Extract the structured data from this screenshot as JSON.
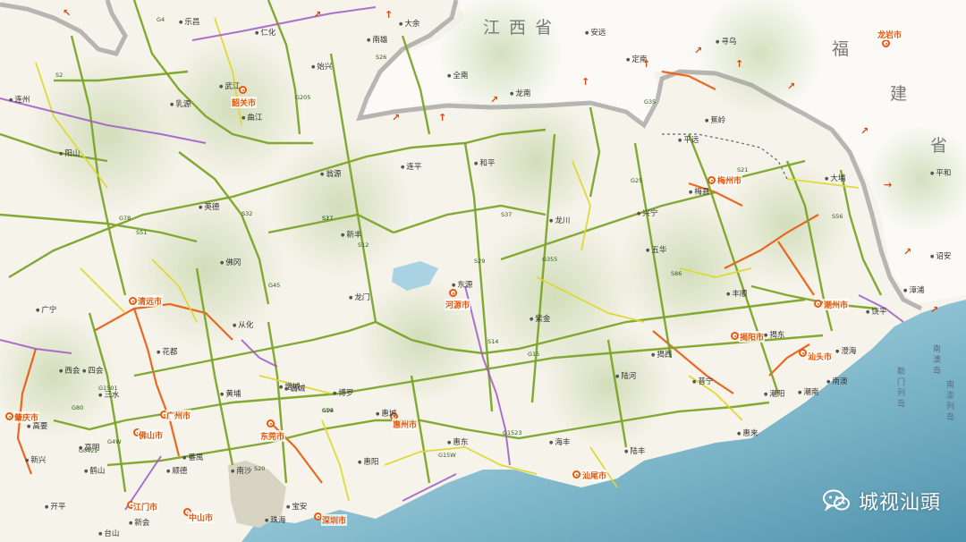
{
  "provinces": [
    {
      "id": "jiangxi",
      "label": "江 西 省"
    },
    {
      "id": "fujian1",
      "label": "福"
    },
    {
      "id": "fujian2",
      "label": "建"
    },
    {
      "id": "fujian3",
      "label": "省"
    }
  ],
  "prefecture_cities": [
    {
      "id": "shaoguan",
      "label": "韶关市"
    },
    {
      "id": "qingyuan",
      "label": "清远市"
    },
    {
      "id": "heyuan",
      "label": "河源市"
    },
    {
      "id": "meizhou",
      "label": "梅州市"
    },
    {
      "id": "chaozhou",
      "label": "潮州市"
    },
    {
      "id": "jieyang",
      "label": "揭阳市"
    },
    {
      "id": "shantou",
      "label": "汕头市"
    },
    {
      "id": "shanwei",
      "label": "汕尾市"
    },
    {
      "id": "huizhou",
      "label": "惠州市"
    },
    {
      "id": "dongguan",
      "label": "东莞市"
    },
    {
      "id": "guangzhou",
      "label": "广州市"
    },
    {
      "id": "foshan",
      "label": "佛山市"
    },
    {
      "id": "zhaoqing",
      "label": "肇庆市"
    },
    {
      "id": "shenzhen",
      "label": "深圳市"
    },
    {
      "id": "zhongshan",
      "label": "中山市"
    },
    {
      "id": "jiangmen",
      "label": "江门市"
    },
    {
      "id": "longyan",
      "label": "龙岩市"
    }
  ],
  "counties": [
    {
      "id": "c1",
      "label": "乐昌"
    },
    {
      "id": "c2",
      "label": "仁化"
    },
    {
      "id": "c3",
      "label": "南雄"
    },
    {
      "id": "c4",
      "label": "始兴"
    },
    {
      "id": "c5",
      "label": "翁源"
    },
    {
      "id": "c6",
      "label": "连平"
    },
    {
      "id": "c7",
      "label": "和平"
    },
    {
      "id": "c8",
      "label": "龙川"
    },
    {
      "id": "c9",
      "label": "平远"
    },
    {
      "id": "c10",
      "label": "蕉岭"
    },
    {
      "id": "c11",
      "label": "大埔"
    },
    {
      "id": "c12",
      "label": "兴宁"
    },
    {
      "id": "c13",
      "label": "五华"
    },
    {
      "id": "c14",
      "label": "丰顺"
    },
    {
      "id": "c15",
      "label": "紫金"
    },
    {
      "id": "c16",
      "label": "东源"
    },
    {
      "id": "c17",
      "label": "新丰"
    },
    {
      "id": "c18",
      "label": "龙门"
    },
    {
      "id": "c19",
      "label": "英德"
    },
    {
      "id": "c20",
      "label": "佛冈"
    },
    {
      "id": "c21",
      "label": "阳山"
    },
    {
      "id": "c22",
      "label": "连州"
    },
    {
      "id": "c23",
      "label": "乳源"
    },
    {
      "id": "c24",
      "label": "曲江"
    },
    {
      "id": "c25",
      "label": "广宁"
    },
    {
      "id": "c26",
      "label": "四会"
    },
    {
      "id": "c27",
      "label": "三水"
    },
    {
      "id": "c28",
      "label": "花都"
    },
    {
      "id": "c29",
      "label": "从化"
    },
    {
      "id": "c30",
      "label": "增城"
    },
    {
      "id": "c31",
      "label": "博罗"
    },
    {
      "id": "c32",
      "label": "惠东"
    },
    {
      "id": "c33",
      "label": "海丰"
    },
    {
      "id": "c34",
      "label": "陆河"
    },
    {
      "id": "c35",
      "label": "陆丰"
    },
    {
      "id": "c36",
      "label": "揭西"
    },
    {
      "id": "c37",
      "label": "普宁"
    },
    {
      "id": "c38",
      "label": "惠来"
    },
    {
      "id": "c39",
      "label": "潮阳"
    },
    {
      "id": "c40",
      "label": "潮南"
    },
    {
      "id": "c41",
      "label": "澄海"
    },
    {
      "id": "c42",
      "label": "饶平"
    },
    {
      "id": "c43",
      "label": "南澳"
    },
    {
      "id": "c44",
      "label": "揭东"
    },
    {
      "id": "c45",
      "label": "惠阳"
    },
    {
      "id": "c46",
      "label": "番禺"
    },
    {
      "id": "c47",
      "label": "南沙"
    },
    {
      "id": "c48",
      "label": "顺德"
    },
    {
      "id": "c49",
      "label": "高明"
    },
    {
      "id": "c50",
      "label": "鹤山"
    },
    {
      "id": "c51",
      "label": "新会"
    },
    {
      "id": "c52",
      "label": "台山"
    },
    {
      "id": "c53",
      "label": "开平"
    },
    {
      "id": "c54",
      "label": "珠海"
    },
    {
      "id": "c55",
      "label": "西会"
    },
    {
      "id": "c56",
      "label": "高要"
    },
    {
      "id": "c57",
      "label": "新兴"
    },
    {
      "id": "c58",
      "label": "武江"
    },
    {
      "id": "c59",
      "label": "翁城"
    },
    {
      "id": "c60",
      "label": "黄埔"
    },
    {
      "id": "c61",
      "label": "宝安"
    },
    {
      "id": "c62",
      "label": "惠城"
    },
    {
      "id": "c63",
      "label": "梅县"
    },
    {
      "id": "c64",
      "label": "平和"
    },
    {
      "id": "c65",
      "label": "漳浦"
    },
    {
      "id": "c66",
      "label": "诏安"
    },
    {
      "id": "c67",
      "label": "安远"
    },
    {
      "id": "c68",
      "label": "定南"
    },
    {
      "id": "c69",
      "label": "寻乌"
    },
    {
      "id": "c70",
      "label": "龙南"
    },
    {
      "id": "c71",
      "label": "全南"
    },
    {
      "id": "c72",
      "label": "大余"
    }
  ],
  "road_codes": [
    "G4",
    "G45",
    "G15",
    "G25",
    "G35",
    "G78",
    "G80",
    "G94",
    "G1523",
    "G0422",
    "S2",
    "S12",
    "S14",
    "S17",
    "S19",
    "S20",
    "S21",
    "S26",
    "S27",
    "S29",
    "S32",
    "S37",
    "S51",
    "S56",
    "S86",
    "G4W",
    "G15W",
    "G1501",
    "G205",
    "G355"
  ],
  "sea_labels": [
    "南澳岛",
    "勒门列岛",
    "南澎列岛"
  ],
  "watermark": {
    "text": "城视汕頭",
    "icon": "wechat-icon"
  },
  "colors": {
    "land": "#f4f1e6",
    "sea": "#7fb3c9",
    "expressway": "#7ba428",
    "planned": "#d9d430",
    "trunk": "#e8590c",
    "railway": "#9b59c9",
    "border": "#8a8a8a"
  }
}
